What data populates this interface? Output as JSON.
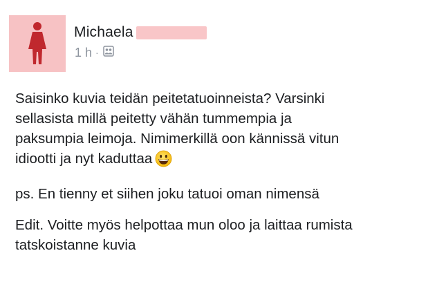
{
  "post": {
    "author": {
      "name": "Michaela",
      "avatar_icon": "female-figure-icon",
      "avatar_color": "#f7c2c4",
      "name_redaction_color": "#f9c6c8"
    },
    "meta": {
      "time": "1 h",
      "separator": "·",
      "privacy_icon": "group-privacy-icon"
    },
    "text": {
      "p1_line1": "Saisinko kuvia teidän peitetatuoinneista? Varsinki",
      "p1_line2": "sellasista millä peitetty vähän tummempia ja",
      "p1_line3": "paksumpia leimoja. Nimimerkillä oon kännissä vitun",
      "p1_line4": "idiootti ja nyt kaduttaa",
      "p1_emoji": "grinning-face-emoji",
      "p2_line1": "ps. En tienny et siihen joku tatuoi oman nimensä",
      "p3_line1": "Edit. Voitte myös helpottaa mun oloo ja laittaa rumista",
      "p3_line2": "tatskoistanne kuvia"
    }
  }
}
